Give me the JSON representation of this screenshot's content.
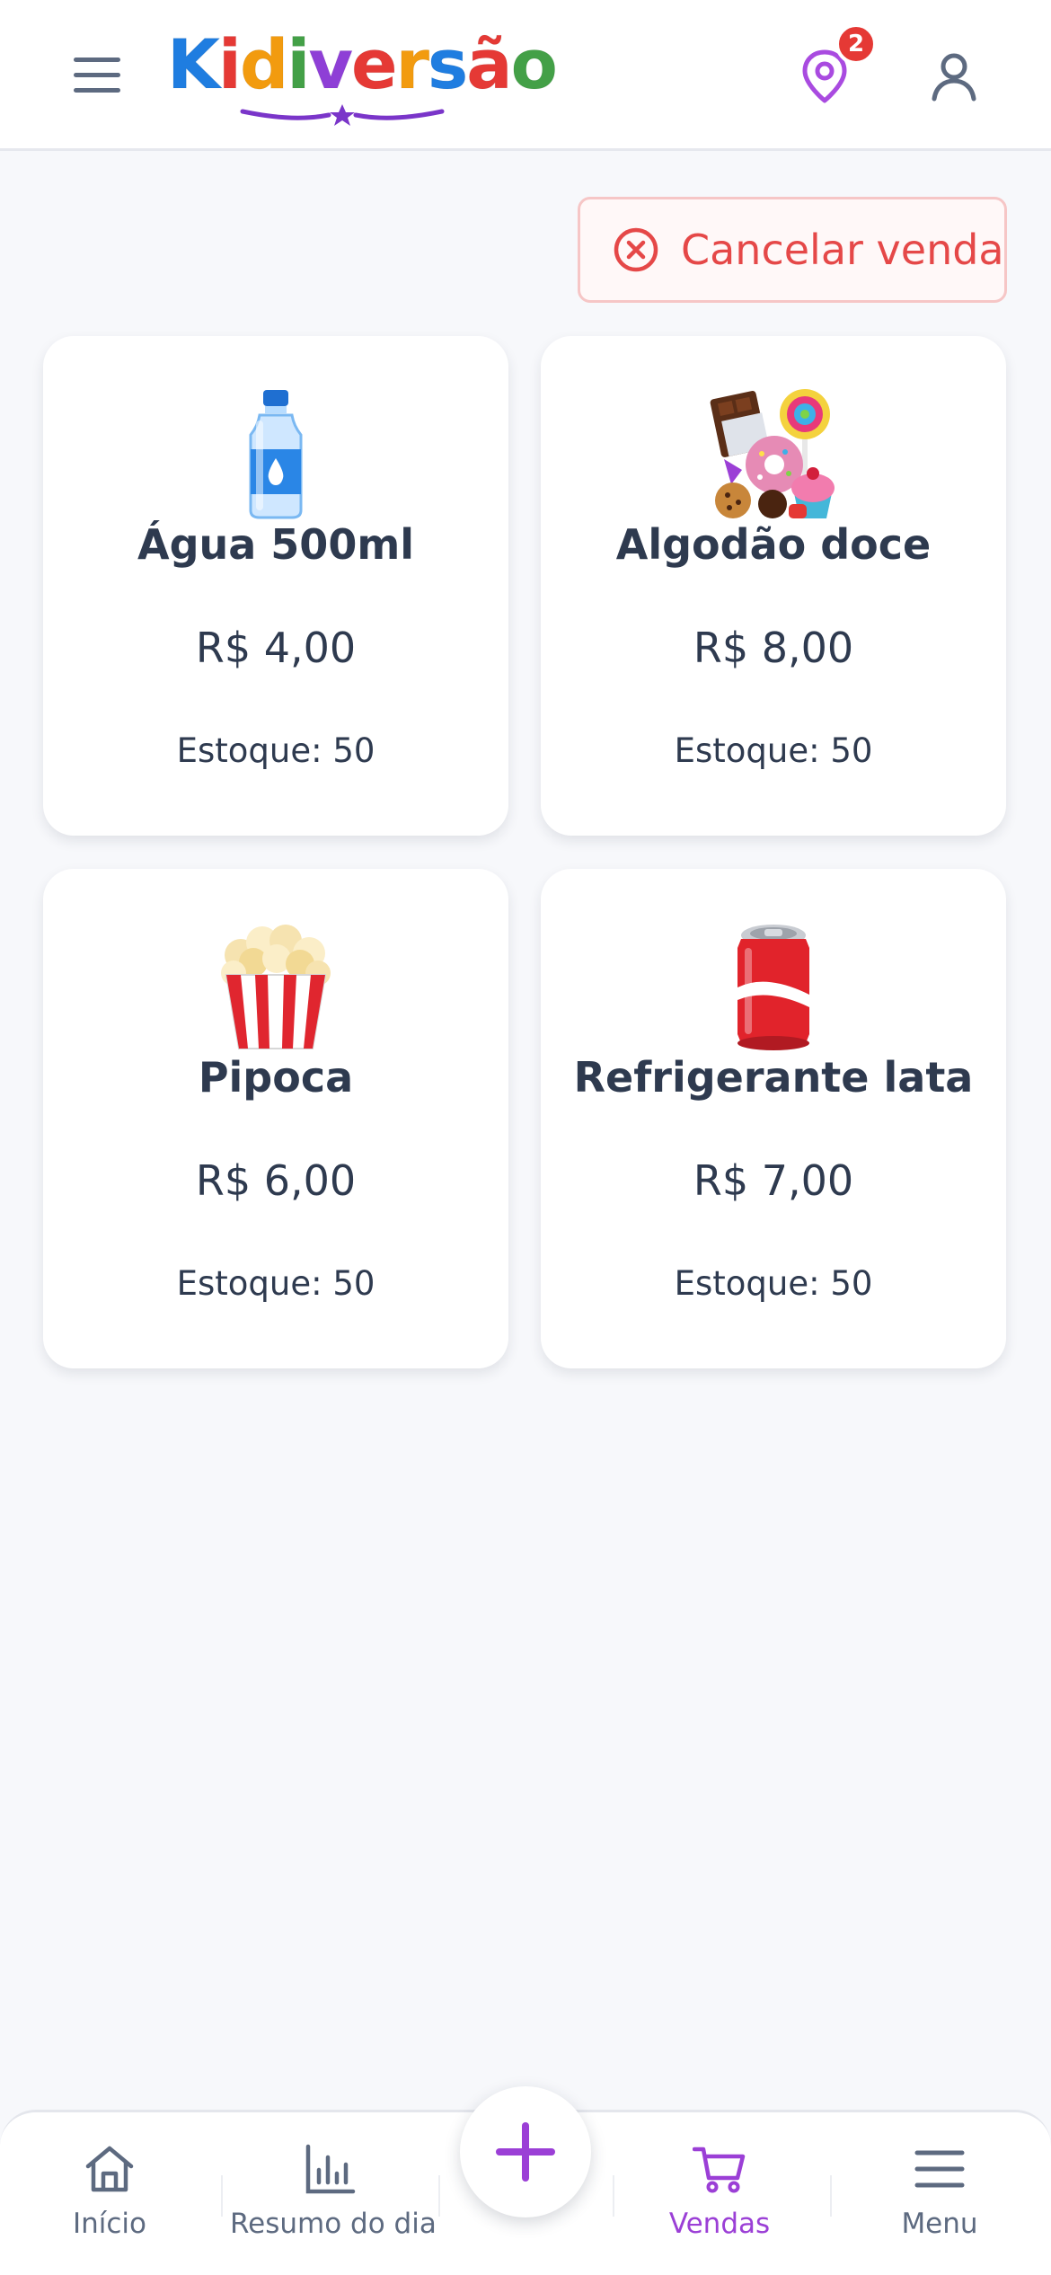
{
  "header": {
    "logo_text": "Kidiversão",
    "notification_count": "2"
  },
  "actions": {
    "cancel_label": "Cancelar venda"
  },
  "products": [
    {
      "name": "Água 500ml",
      "price": "R$ 4,00",
      "stock": "Estoque: 50",
      "icon": "water-bottle-icon"
    },
    {
      "name": "Algodão doce",
      "price": "R$ 8,00",
      "stock": "Estoque: 50",
      "icon": "sweets-icon"
    },
    {
      "name": "Pipoca",
      "price": "R$ 6,00",
      "stock": "Estoque: 50",
      "icon": "popcorn-icon"
    },
    {
      "name": "Refrigerante lata",
      "price": "R$ 7,00",
      "stock": "Estoque: 50",
      "icon": "soda-can-icon"
    }
  ],
  "bottom_nav": {
    "items": [
      {
        "label": "Início",
        "icon": "home-icon"
      },
      {
        "label": "Resumo do dia",
        "icon": "bar-chart-icon"
      },
      {
        "label": "Vendas",
        "icon": "cart-icon",
        "active": true
      },
      {
        "label": "Menu",
        "icon": "menu-icon"
      }
    ],
    "fab_icon": "plus-icon"
  },
  "colors": {
    "accent": "#9b3fd6",
    "danger": "#e54848",
    "text": "#2e3a4f",
    "muted": "#5d6a80",
    "background": "#f7f8fb"
  }
}
